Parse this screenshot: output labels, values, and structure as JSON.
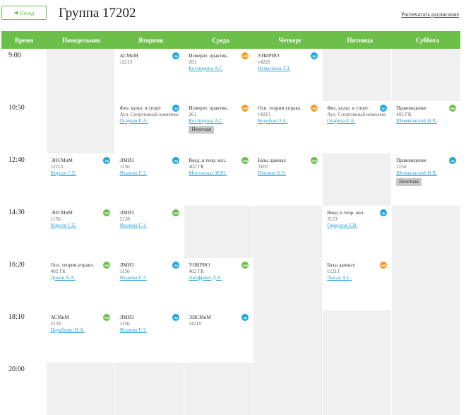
{
  "header": {
    "back_label": "Назад",
    "title": "Группа 17202",
    "print_link": "Распечатать расписание"
  },
  "days": [
    "Время",
    "Понедельник",
    "Вторник",
    "Среда",
    "Четверг",
    "Пятница",
    "Суббота"
  ],
  "colors": {
    "accent": "#6cc04a",
    "lecture_badge": "#6cc04a",
    "practice_badge": "#1aa7dd",
    "lab_badge": "#f39a1e"
  },
  "rows": [
    {
      "time": "9:00",
      "cells": [
        null,
        {
          "subject": "АСМиМ",
          "room": "т2213",
          "teacher": "",
          "badge": "пр",
          "badge_color": "blue"
        },
        {
          "subject": "Измерит. практик.",
          "room": "261",
          "teacher": "Костюрина А.Г.",
          "badge": "лаб",
          "badge_color": "orange"
        },
        {
          "subject": "УНИРИО",
          "room": "т4220",
          "teacher": "Исмагилов Т.З.",
          "badge": "пр",
          "badge_color": "blue"
        },
        null,
        null
      ]
    },
    {
      "time": "10:50",
      "cells": [
        null,
        {
          "subject": "Физ. культ. и спорт",
          "room": "Аул. Спортивный комплекс",
          "teacher": "Огарков Е.А.",
          "badge": "пр",
          "badge_color": "blue"
        },
        {
          "subject": "Измерит. практик.",
          "room": "261",
          "teacher": "Костюрина А.Г.",
          "tag": "Нечетная",
          "badge": "лаб",
          "badge_color": "orange"
        },
        {
          "subject": "Осн. теории управл.",
          "room": "т4213",
          "teacher": "Коробов О.А.",
          "badge": "лаб",
          "badge_color": "orange"
        },
        {
          "subject": "Физ. культ. и спорт",
          "room": "Аул. Спортивный комплекс",
          "teacher": "Огарков Е.А.",
          "badge": "пр",
          "badge_color": "blue"
        },
        {
          "subject": "Правоведение",
          "room": "402 ГК",
          "teacher": "Шемяковский В.В.",
          "badge": "лек",
          "badge_color": "green"
        }
      ]
    },
    {
      "time": "12:40",
      "cells": [
        {
          "subject": "ЭНСМиМ",
          "room": "т2213",
          "teacher": "Кирсев С.Е.",
          "badge": "пр",
          "badge_color": "blue"
        },
        {
          "subject": "ЛМИЗ",
          "room": "1156",
          "teacher": "Яхъяева Г.Э.",
          "badge": "пр",
          "badge_color": "blue"
        },
        {
          "subject": "Введ. в теор. кол.",
          "room": "402 ГК",
          "teacher": "Могильных И.Ю.",
          "badge": "лек",
          "badge_color": "green"
        },
        {
          "subject": "Базы данных",
          "room": "3107",
          "teacher": "Пешкин Б.Н.",
          "badge": "лек",
          "badge_color": "green"
        },
        null,
        {
          "subject": "Правоведение",
          "room": "1156",
          "teacher": "Шемяковский В.В.",
          "tag": "Нечетная",
          "badge": "пр",
          "badge_color": "blue"
        }
      ]
    },
    {
      "time": "14:30",
      "cells": [
        {
          "subject": "ЭНСМиМ",
          "room": "1156",
          "teacher": "Кирсев С.Е.",
          "badge": "лек",
          "badge_color": "green"
        },
        {
          "subject": "ЛМИЗ",
          "room": "2128",
          "teacher": "Яхъяева Г.Э.",
          "badge": "лек",
          "badge_color": "green"
        },
        null,
        null,
        {
          "subject": "Введ. в теор. кол.",
          "room": "3123",
          "teacher": "Горкунов Е.В.",
          "badge": "пр",
          "badge_color": "blue"
        },
        null
      ]
    },
    {
      "time": "16:20",
      "cells": [
        {
          "subject": "Осн. теории управл.",
          "room": "402 ГК",
          "teacher": "Донов А.А.",
          "badge": "лек",
          "badge_color": "green"
        },
        {
          "subject": "ЛМИЗ",
          "room": "1156",
          "teacher": "Яхъяева Г.Э.",
          "badge": "пр",
          "badge_color": "blue"
        },
        {
          "subject": "УНИРИО",
          "room": "402 ГК",
          "teacher": "Анофриев Д.А.",
          "badge": "лек",
          "badge_color": "green"
        },
        null,
        {
          "subject": "Базы данных",
          "room": "т2213",
          "teacher": "Лысак А.С.",
          "badge": "лаб",
          "badge_color": "orange"
        },
        null
      ]
    },
    {
      "time": "18:10",
      "cells": [
        {
          "subject": "АСМиМ",
          "room": "2128",
          "teacher": "Церебенко И.А.",
          "badge": "лек",
          "badge_color": "green"
        },
        {
          "subject": "ЛМИЗ",
          "room": "1156",
          "teacher": "Яхъяева Г.Э.",
          "badge": "пр",
          "badge_color": "blue"
        },
        {
          "subject": "ЭНСМиМ",
          "room": "т4210",
          "teacher": "",
          "badge": "пр",
          "badge_color": "blue"
        },
        null,
        null,
        null
      ]
    },
    {
      "time": "20:00",
      "cells": [
        null,
        null,
        null,
        null,
        null,
        null
      ]
    }
  ]
}
